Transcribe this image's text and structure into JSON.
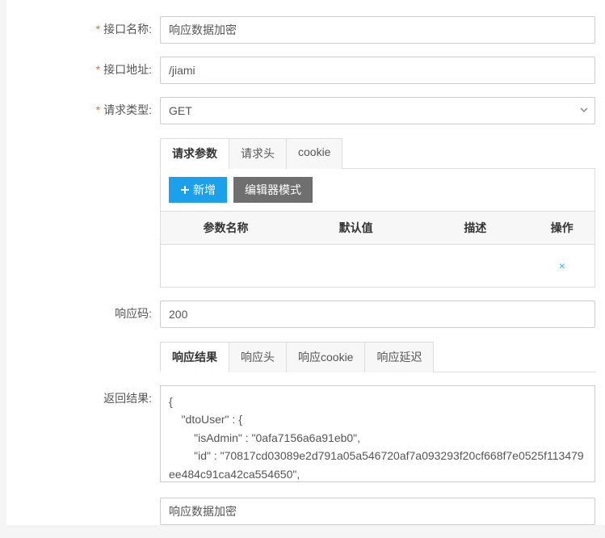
{
  "labels": {
    "interfaceName": "接口名称:",
    "interfaceAddress": "接口地址:",
    "requestType": "请求类型:",
    "responseCode": "响应码:",
    "returnResult": "返回结果:"
  },
  "values": {
    "interfaceName": "响应数据加密",
    "interfaceAddress": "/jiami",
    "requestType": "GET",
    "responseCode": "200",
    "returnResult": "{\n    \"dtoUser\" : {\n        \"isAdmin\" : \"0afa7156a6a91eb0\",\n        \"id\" : \"70817cd03089e2d791a05a546720af7a093293f20cf668f7e0525f113479ee484c91ca42ca554650\",",
    "bottomField": "响应数据加密"
  },
  "requestTabs": [
    {
      "label": "请求参数",
      "active": true
    },
    {
      "label": "请求头",
      "active": false
    },
    {
      "label": "cookie",
      "active": false
    }
  ],
  "responseTabs": [
    {
      "label": "响应结果",
      "active": true
    },
    {
      "label": "响应头",
      "active": false
    },
    {
      "label": "响应cookie",
      "active": false
    },
    {
      "label": "响应延迟",
      "active": false
    }
  ],
  "toolbar": {
    "add": "新增",
    "editorMode": "编辑器模式"
  },
  "paramsTable": {
    "headers": {
      "name": "参数名称",
      "default": "默认值",
      "desc": "描述",
      "action": "操作"
    },
    "deleteIcon": "×"
  }
}
